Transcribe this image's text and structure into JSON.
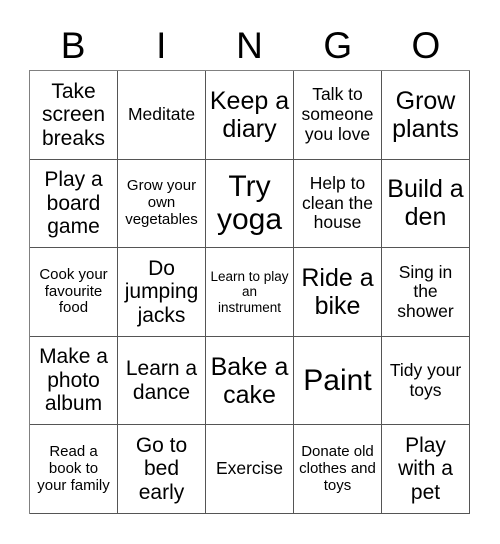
{
  "card": {
    "title_letters": [
      "B",
      "I",
      "N",
      "G",
      "O"
    ],
    "columns": 5,
    "rows": 5,
    "colors": {
      "background": "#ffffff",
      "text": "#000000",
      "grid_line": "#555555",
      "outer_line": "#808080"
    },
    "cells": [
      {
        "text": "Take screen breaks",
        "size": "l"
      },
      {
        "text": "Meditate",
        "size": "m"
      },
      {
        "text": "Keep a diary",
        "size": "xl"
      },
      {
        "text": "Talk to someone you love",
        "size": "m"
      },
      {
        "text": "Grow plants",
        "size": "xl"
      },
      {
        "text": "Play a board game",
        "size": "l"
      },
      {
        "text": "Grow your own vegetables",
        "size": "s"
      },
      {
        "text": "Try yoga",
        "size": "xxl"
      },
      {
        "text": "Help to clean the house",
        "size": "m"
      },
      {
        "text": "Build a den",
        "size": "xl"
      },
      {
        "text": "Cook your favourite food",
        "size": "s"
      },
      {
        "text": "Do jumping jacks",
        "size": "l"
      },
      {
        "text": "Learn to play an instrument",
        "size": "xs"
      },
      {
        "text": "Ride a bike",
        "size": "xl"
      },
      {
        "text": "Sing in the shower",
        "size": "m"
      },
      {
        "text": "Make a photo album",
        "size": "l"
      },
      {
        "text": "Learn a dance",
        "size": "l"
      },
      {
        "text": "Bake a cake",
        "size": "xl"
      },
      {
        "text": "Paint",
        "size": "xxl"
      },
      {
        "text": "Tidy your toys",
        "size": "m"
      },
      {
        "text": "Read a book to your family",
        "size": "s"
      },
      {
        "text": "Go to bed early",
        "size": "l"
      },
      {
        "text": "Exercise",
        "size": "m"
      },
      {
        "text": "Donate old clothes and toys",
        "size": "s"
      },
      {
        "text": "Play with a pet",
        "size": "l"
      }
    ]
  }
}
